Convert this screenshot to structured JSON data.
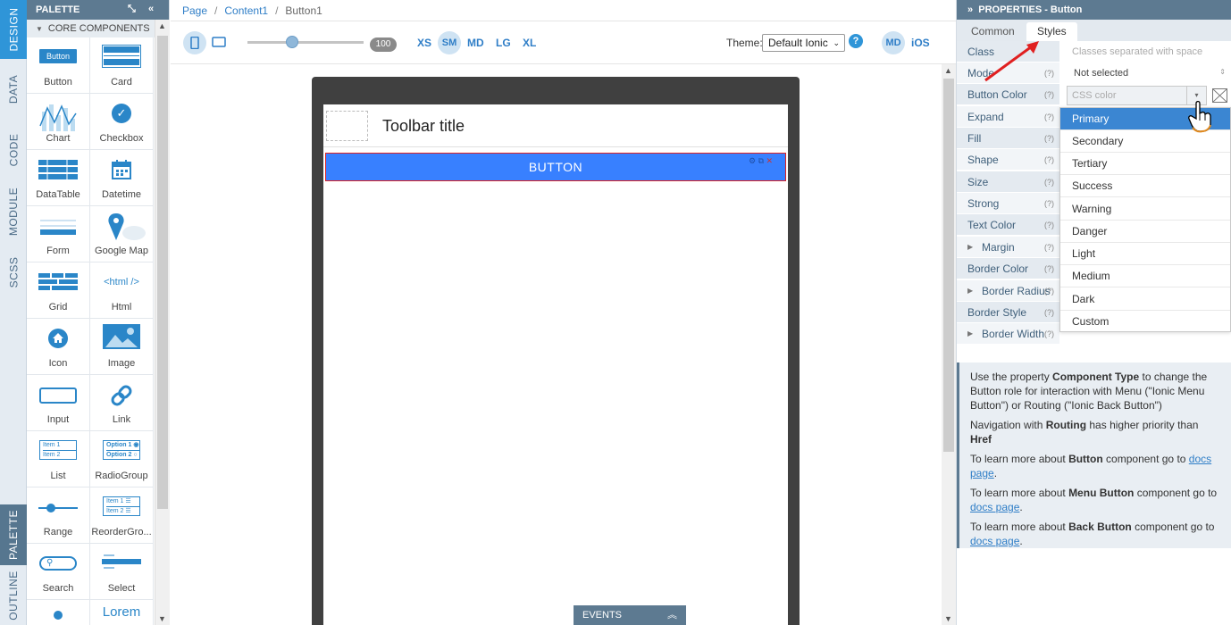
{
  "side_tabs": {
    "design": "DESIGN",
    "data": "DATA",
    "code": "CODE",
    "module": "MODULE",
    "scss": "SCSS",
    "palette": "PALETTE",
    "outline": "OUTLINE"
  },
  "palette": {
    "title": "PALETTE",
    "section": "CORE COMPONENTS",
    "items": [
      {
        "label": "Button"
      },
      {
        "label": "Card"
      },
      {
        "label": "Chart"
      },
      {
        "label": "Checkbox"
      },
      {
        "label": "DataTable"
      },
      {
        "label": "Datetime"
      },
      {
        "label": "Form"
      },
      {
        "label": "Google Map"
      },
      {
        "label": "Grid"
      },
      {
        "label": "Html"
      },
      {
        "label": "Icon"
      },
      {
        "label": "Image"
      },
      {
        "label": "Input"
      },
      {
        "label": "Link"
      },
      {
        "label": "List"
      },
      {
        "label": "RadioGroup"
      },
      {
        "label": "Range"
      },
      {
        "label": "ReorderGro..."
      },
      {
        "label": "Search"
      },
      {
        "label": "Select"
      }
    ],
    "icon_text": {
      "button": "Button",
      "html": "<html />",
      "lorem": "Lorem",
      "item1": "Item 1",
      "item2": "Item 2",
      "option1": "Option 1",
      "option2": "Option 2"
    }
  },
  "breadcrumb": {
    "page": "Page",
    "content": "Content1",
    "current": "Button1"
  },
  "toolbar": {
    "zoom": "100",
    "breakpoints": [
      "XS",
      "SM",
      "MD",
      "LG",
      "XL"
    ],
    "theme_label": "Theme:",
    "theme_value": "Default Ionic",
    "help": "?",
    "md": "MD",
    "ios": "iOS"
  },
  "canvas": {
    "toolbar_title": "Toolbar title",
    "button_text": "BUTTON",
    "events": "EVENTS"
  },
  "properties": {
    "title": "PROPERTIES - Button",
    "tabs": {
      "common": "Common",
      "styles": "Styles"
    },
    "rows": [
      "Class",
      "Mode",
      "Button Color",
      "Expand",
      "Fill",
      "Shape",
      "Size",
      "Strong",
      "Text Color",
      "Margin",
      "Border Color",
      "Border Radius",
      "Border Style",
      "Border Width"
    ],
    "q": "(?)",
    "class_placeholder": "Classes separated with space",
    "mode_value": "Not selected",
    "color_placeholder": "CSS color",
    "color_options": [
      "Primary",
      "Secondary",
      "Tertiary",
      "Success",
      "Warning",
      "Danger",
      "Light",
      "Medium",
      "Dark",
      "Custom"
    ]
  },
  "info": {
    "p1a": "Use the property ",
    "p1b": "Component Type",
    "p1c": " to change the Button role for interaction with Menu (\"Ionic Menu Button\") or Routing (\"Ionic Back Button\")",
    "p2a": "Navigation with ",
    "p2b": "Routing",
    "p2c": " has higher priority than ",
    "p2d": "Href",
    "p3a": "To learn more about ",
    "p3b": "Button",
    "p3c": " component go to ",
    "p3d": "docs page",
    "p4a": "To learn more about ",
    "p4b": "Menu Button",
    "p4c": " component go to ",
    "p4d": "docs page",
    "p5a": "To learn more about ",
    "p5b": "Back Button",
    "p5c": " component go to ",
    "p5d": "docs page"
  },
  "colors": {
    "accent": "#2f95d8",
    "header": "#5d7a91",
    "button": "#3880ff",
    "selected": "#3b86d2",
    "arrow": "#e02020"
  }
}
